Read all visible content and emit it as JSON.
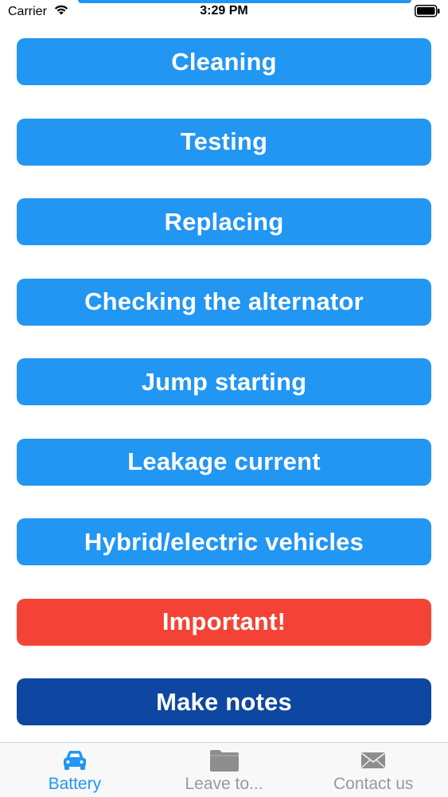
{
  "status_bar": {
    "carrier": "Carrier",
    "time": "3:29 PM"
  },
  "menu": {
    "items": [
      {
        "label": "Cleaning",
        "color": "#2196f3"
      },
      {
        "label": "Testing",
        "color": "#2196f3"
      },
      {
        "label": "Replacing",
        "color": "#2196f3"
      },
      {
        "label": "Checking the alternator",
        "color": "#2196f3"
      },
      {
        "label": "Jump starting",
        "color": "#2196f3"
      },
      {
        "label": "Leakage current",
        "color": "#2196f3"
      },
      {
        "label": "Hybrid/electric vehicles",
        "color": "#2196f3"
      },
      {
        "label": "Important!",
        "color": "#f44336"
      },
      {
        "label": "Make notes",
        "color": "#0d47a1"
      }
    ]
  },
  "tab_bar": {
    "tabs": [
      {
        "label": "Battery",
        "icon": "car-icon",
        "active": true,
        "color": "#2196f3"
      },
      {
        "label": "Leave to...",
        "icon": "folder-icon",
        "active": false,
        "color": "#999999"
      },
      {
        "label": "Contact us",
        "icon": "envelope-icon",
        "active": false,
        "color": "#999999"
      }
    ]
  }
}
